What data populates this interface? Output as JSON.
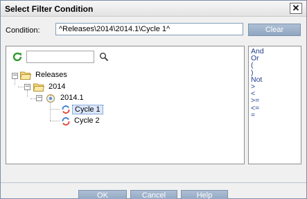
{
  "window": {
    "title": "Select Filter Condition",
    "close_glyph": "✕"
  },
  "condition": {
    "label": "Condition:",
    "value": "^Releases\\2014\\2014.1\\Cycle 1^",
    "clear_label": "Clear"
  },
  "tree": {
    "search_value": "",
    "nodes": {
      "releases": "Releases",
      "year_2014": "2014",
      "release_2014_1": "2014.1",
      "cycle_1": "Cycle 1",
      "cycle_2": "Cycle 2"
    },
    "selected": "Cycle 1"
  },
  "operators": [
    "And",
    "Or",
    "(",
    ")",
    "Not",
    ">",
    "<",
    ">=",
    "<=",
    "="
  ],
  "footer": {
    "ok_label": "OK",
    "cancel_label": "Cancel",
    "help_label": "Help"
  }
}
